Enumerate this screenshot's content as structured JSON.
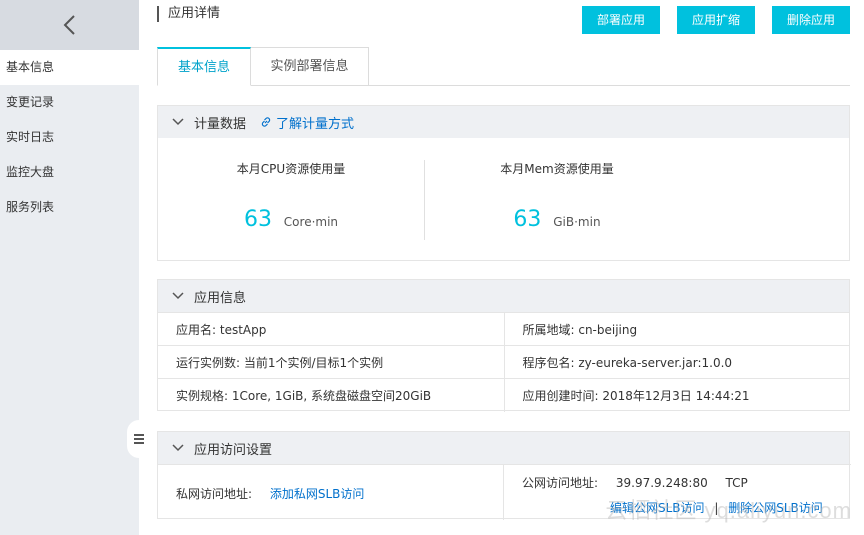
{
  "sidebar": {
    "back_icon": "chevron-left-icon",
    "items": [
      {
        "label": "基本信息",
        "active": true
      },
      {
        "label": "变更记录",
        "active": false
      },
      {
        "label": "实时日志",
        "active": false
      },
      {
        "label": "监控大盘",
        "active": false
      },
      {
        "label": "服务列表",
        "active": false
      }
    ]
  },
  "header": {
    "title": "应用详情",
    "buttons": {
      "deploy": "部署应用",
      "scale": "应用扩缩",
      "delete": "删除应用"
    }
  },
  "tabs": {
    "basic": "基本信息",
    "deploy_info": "实例部署信息"
  },
  "metering": {
    "title": "计量数据",
    "help_link": "了解计量方式",
    "cpu": {
      "label": "本月CPU资源使用量",
      "value": "63",
      "unit": "Core·min"
    },
    "mem": {
      "label": "本月Mem资源使用量",
      "value": "63",
      "unit": "GiB·min"
    }
  },
  "app_info": {
    "title": "应用信息",
    "rows": [
      {
        "left": "应用名: testApp",
        "right": "所属地域: cn-beijing"
      },
      {
        "left": "运行实例数: 当前1个实例/目标1个实例",
        "right": "程序包名: zy-eureka-server.jar:1.0.0"
      },
      {
        "left": "实例规格: 1Core, 1GiB, 系统盘磁盘空间20GiB",
        "right": "应用创建时间: 2018年12月3日 14:44:21"
      }
    ]
  },
  "access": {
    "title": "应用访问设置",
    "private_label": "私网访问地址:",
    "private_link": "添加私网SLB访问",
    "public_label": "公网访问地址:",
    "public_value": "39.97.9.248:80",
    "public_protocol": "TCP",
    "edit_link": "编辑公网SLB访问",
    "separator": "|",
    "delete_link": "删除公网SLB访问"
  },
  "watermark": "云栖社区 yq.aliyun.com",
  "colors": {
    "accent": "#00c1de",
    "link": "#0070cc",
    "sidebar_bg": "#eaedf1",
    "section_head_bg": "#eef0f3"
  }
}
